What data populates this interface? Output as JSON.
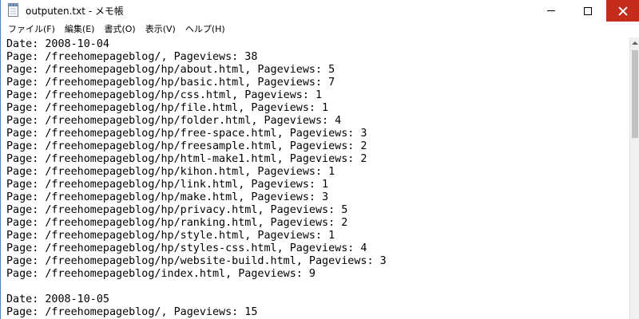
{
  "window": {
    "title": "outputen.txt - メモ帳"
  },
  "menu": {
    "items": [
      {
        "label": "ファイル(F)"
      },
      {
        "label": "編集(E)"
      },
      {
        "label": "書式(O)"
      },
      {
        "label": "表示(V)"
      },
      {
        "label": "ヘルプ(H)"
      }
    ]
  },
  "editor": {
    "lines": [
      "Date: 2008-10-04",
      "Page: /freehomepageblog/, Pageviews: 38",
      "Page: /freehomepageblog/hp/about.html, Pageviews: 5",
      "Page: /freehomepageblog/hp/basic.html, Pageviews: 7",
      "Page: /freehomepageblog/hp/css.html, Pageviews: 1",
      "Page: /freehomepageblog/hp/file.html, Pageviews: 1",
      "Page: /freehomepageblog/hp/folder.html, Pageviews: 4",
      "Page: /freehomepageblog/hp/free-space.html, Pageviews: 3",
      "Page: /freehomepageblog/hp/freesample.html, Pageviews: 2",
      "Page: /freehomepageblog/hp/html-make1.html, Pageviews: 2",
      "Page: /freehomepageblog/hp/kihon.html, Pageviews: 1",
      "Page: /freehomepageblog/hp/link.html, Pageviews: 1",
      "Page: /freehomepageblog/hp/make.html, Pageviews: 3",
      "Page: /freehomepageblog/hp/privacy.html, Pageviews: 5",
      "Page: /freehomepageblog/hp/ranking.html, Pageviews: 2",
      "Page: /freehomepageblog/hp/style.html, Pageviews: 1",
      "Page: /freehomepageblog/hp/styles-css.html, Pageviews: 4",
      "Page: /freehomepageblog/hp/website-build.html, Pageviews: 3",
      "Page: /freehomepageblog/index.html, Pageviews: 9",
      "",
      "Date: 2008-10-05",
      "Page: /freehomepageblog/, Pageviews: 15"
    ]
  },
  "colors": {
    "close_button": "#c42b1c",
    "window_border": "#4a86c8",
    "scroll_thumb": "#c2c2c2"
  },
  "icons": {
    "app": "notepad-document-icon",
    "minimize": "minimize-icon",
    "maximize": "maximize-icon",
    "close": "close-icon"
  }
}
